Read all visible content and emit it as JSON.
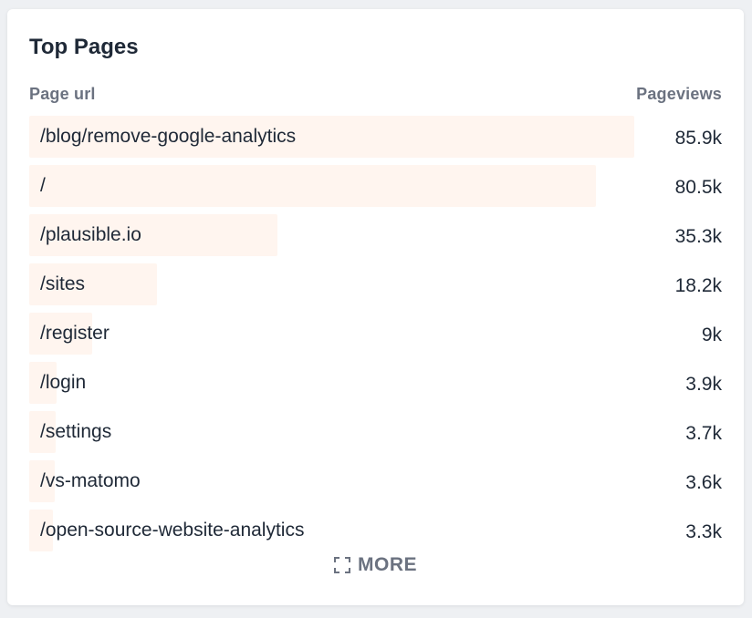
{
  "card": {
    "title": "Top Pages",
    "columns": {
      "url": "Page url",
      "views": "Pageviews"
    },
    "rows": [
      {
        "url": "/blog/remove-google-analytics",
        "views": "85.9k",
        "count": 85900
      },
      {
        "url": "/",
        "views": "80.5k",
        "count": 80500
      },
      {
        "url": "/plausible.io",
        "views": "35.3k",
        "count": 35300
      },
      {
        "url": "/sites",
        "views": "18.2k",
        "count": 18200
      },
      {
        "url": "/register",
        "views": "9k",
        "count": 9000
      },
      {
        "url": "/login",
        "views": "3.9k",
        "count": 3900
      },
      {
        "url": "/settings",
        "views": "3.7k",
        "count": 3700
      },
      {
        "url": "/vs-matomo",
        "views": "3.6k",
        "count": 3600
      },
      {
        "url": "/open-source-website-analytics",
        "views": "3.3k",
        "count": 3300
      }
    ],
    "more": {
      "label": "MORE",
      "icon": "expand-icon"
    }
  },
  "colors": {
    "bar": "#fff5ef",
    "text": "#1f2937",
    "muted": "#6b7280"
  }
}
